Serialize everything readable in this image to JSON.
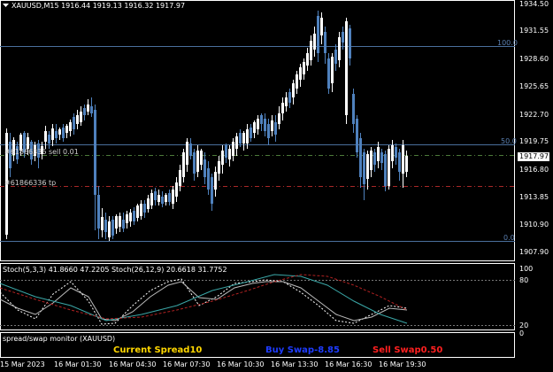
{
  "header": {
    "menu_arrow": "triangle-down-icon",
    "symbol": "XAUUSD,M15",
    "ohlc": "1916.44 1919.13 1916.32 1917.97"
  },
  "price_axis": {
    "ticks": [
      "1934.50",
      "1931.55",
      "1928.60",
      "1925.65",
      "1922.70",
      "1919.75",
      "1916.80",
      "1913.85",
      "1910.90",
      "1907.90"
    ],
    "current_price": "1917.97"
  },
  "fib_levels": {
    "top_label": "100.0",
    "mid_label": "50.0",
    "low_label": "0.0"
  },
  "orders": {
    "sell_label": "#61866336 sell 0.01",
    "tp_label": "#61866336 tp"
  },
  "stoch": {
    "legend": "Stoch(5,3,3) 41.8660 47.2205  Stoch(26,12,9) 20.6618 31.7752",
    "axis": [
      "100",
      "80",
      "20",
      "0"
    ]
  },
  "monitor": {
    "title": "spread/swap monitor (XAUUSD)",
    "current_spread_label": "Current Spread",
    "current_spread_value": "10",
    "buy_swap_label": "Buy Swap",
    "buy_swap_value": "-8.85",
    "sell_swap_label": "Sell Swap",
    "sell_swap_value": "0.50",
    "colors": {
      "spread": "#ffd700",
      "buy": "#1e3cff",
      "sell": "#ff2020"
    }
  },
  "time_axis": [
    "15 Mar 2023",
    "16 Mar 01:30",
    "16 Mar 04:30",
    "16 Mar 07:30",
    "16 Mar 10:30",
    "16 Mar 13:30",
    "16 Mar 16:30",
    "16 Mar 19:30"
  ],
  "colors": {
    "bull": "#ffffff",
    "bear": "#4f81bd",
    "grid": "#ffffff"
  }
}
